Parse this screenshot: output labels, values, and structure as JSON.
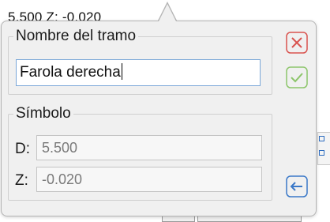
{
  "background": {
    "coords_text": "5.500  Z: -0.020"
  },
  "popup": {
    "name_group": {
      "title": "Nombre del tramo",
      "input_value": "Farola derecha"
    },
    "symbol_group": {
      "title": "Símbolo",
      "d_label": "D:",
      "d_value": "5.500",
      "z_label": "Z:",
      "z_value": "-0.020"
    },
    "buttons": {
      "cancel_icon": "close-icon",
      "accept_icon": "check-icon",
      "back_icon": "arrow-left-icon"
    }
  },
  "colors": {
    "cancel": "#d9534f",
    "accept": "#8cc56a",
    "back": "#3a78c8"
  }
}
